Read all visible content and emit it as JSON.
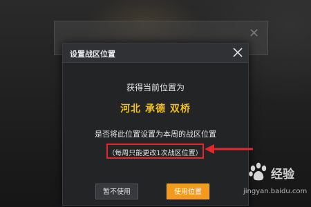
{
  "background": {
    "close_glyph": "✕"
  },
  "dialog": {
    "title": "设置战区位置",
    "close_icon": "close-icon",
    "line1": "获得当前位置为",
    "location": "河北 承德 双桥",
    "line2": "是否将此位置设置为本周的战区位置",
    "note": "（每周只能更改1次战区位置）",
    "buttons": {
      "cancel": "暂不使用",
      "confirm": "使用位置"
    }
  },
  "watermark": {
    "text": "经验",
    "url": "jingyan.baidu.com"
  },
  "colors": {
    "location": "#f2c018",
    "confirm_button": "#f39a1c",
    "annotation": "#e3282d"
  }
}
